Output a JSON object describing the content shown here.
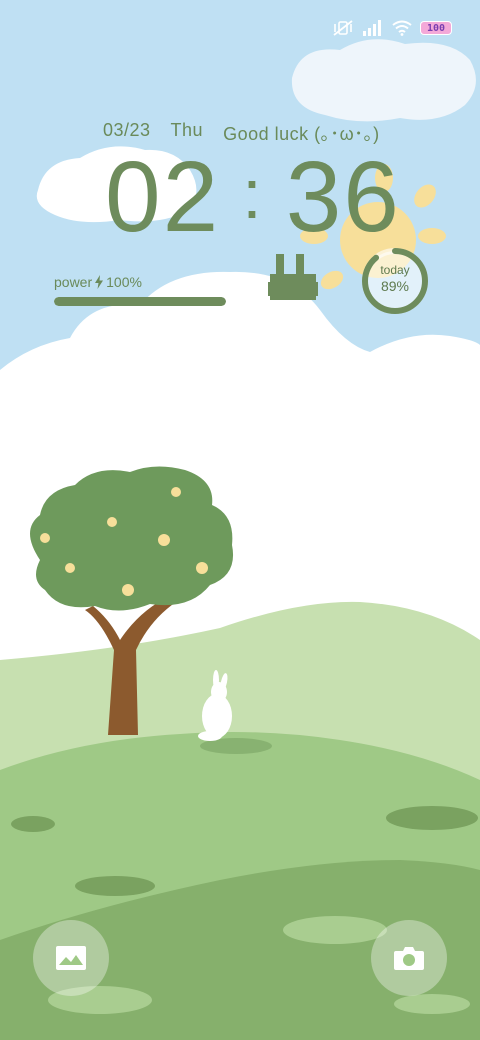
{
  "status_bar": {
    "icons": [
      "vibrate-off-icon",
      "signal-icon",
      "wifi-icon",
      "battery-icon"
    ],
    "battery_level": "100",
    "battery_color": "#f4a9d8"
  },
  "lock_screen": {
    "date": "03/23",
    "weekday": "Thu",
    "greeting": "Good luck (｡･ω･｡)",
    "clock_hours": "02",
    "clock_separator": ":",
    "clock_minutes": "36"
  },
  "power_widget": {
    "label": "power",
    "percent_text": "100%",
    "level": 1.0,
    "color": "#6e8c5c"
  },
  "today_widget": {
    "label": "today",
    "value_text": "89%",
    "progress": 0.89
  },
  "shortcuts": {
    "left_icon": "gallery-icon",
    "right_icon": "camera-icon"
  },
  "colors": {
    "sky": "#bfe0f3",
    "hill_light": "#c7e0b0",
    "hill_mid": "#9fc986",
    "hill_dark": "#86b06c",
    "accent_green": "#6e8c5c",
    "sun": "#f7df9a"
  }
}
